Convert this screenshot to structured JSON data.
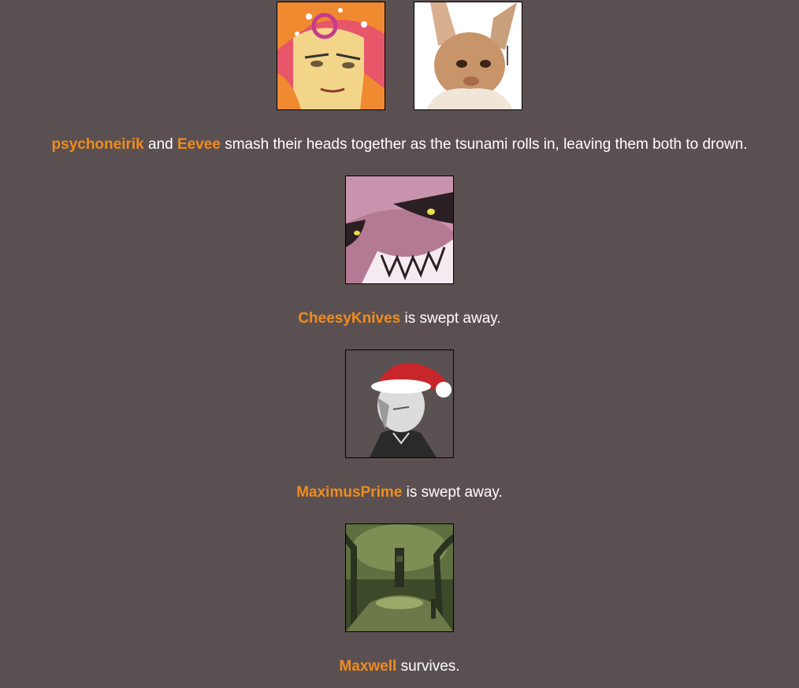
{
  "events": [
    {
      "players": [
        "psychoneirik",
        "Eevee"
      ],
      "text_connector": "and",
      "text_rest": "smash their heads together as the tsunami rolls in, leaving them both to drown."
    },
    {
      "players": [
        "CheesyKnives"
      ],
      "text_rest": "is swept away."
    },
    {
      "players": [
        "MaximusPrime"
      ],
      "text_rest": "is swept away."
    },
    {
      "players": [
        "Maxwell"
      ],
      "text_rest": "survives."
    }
  ],
  "colors": {
    "background": "#5b5051",
    "name": "#f08c1e",
    "text": "#ffffff"
  },
  "avatars": {
    "psychoneirik": "anime-portrait-icon",
    "Eevee": "furry-creature-icon",
    "CheesyKnives": "grinning-mask-icon",
    "MaximusPrime": "santa-hat-character-icon",
    "Maxwell": "forest-scene-icon"
  }
}
